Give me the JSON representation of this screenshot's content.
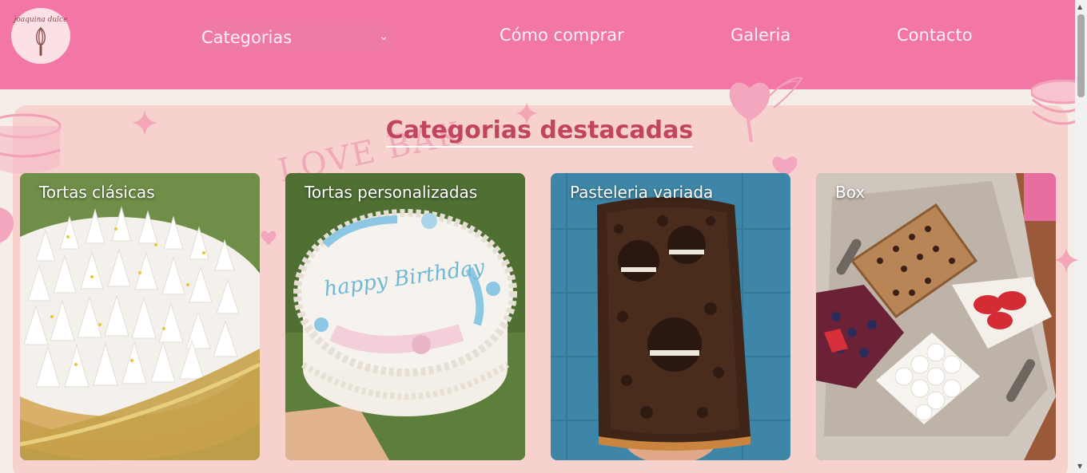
{
  "brand": {
    "logo_text": "joaquina dulce"
  },
  "nav": {
    "categories_select": "Categorias",
    "how_to_buy": "Cómo comprar",
    "gallery": "Galeria",
    "contact": "Contacto"
  },
  "main": {
    "section_title": "Categorias destacadas",
    "background_text": "LOVE BAK",
    "cards": [
      {
        "label": "Tortas clásicas"
      },
      {
        "label": "Tortas personalizadas"
      },
      {
        "label": "Pasteleria variada"
      },
      {
        "label": "Box"
      }
    ]
  },
  "colors": {
    "header_pink": "#f276a6",
    "panel_pink": "#f6d1ce",
    "title_red": "#c2455f",
    "cream": "#f5eee7"
  },
  "icons": [
    "whisk-icon",
    "chevron-down-icon",
    "sparkle-icon",
    "heart-icon"
  ]
}
